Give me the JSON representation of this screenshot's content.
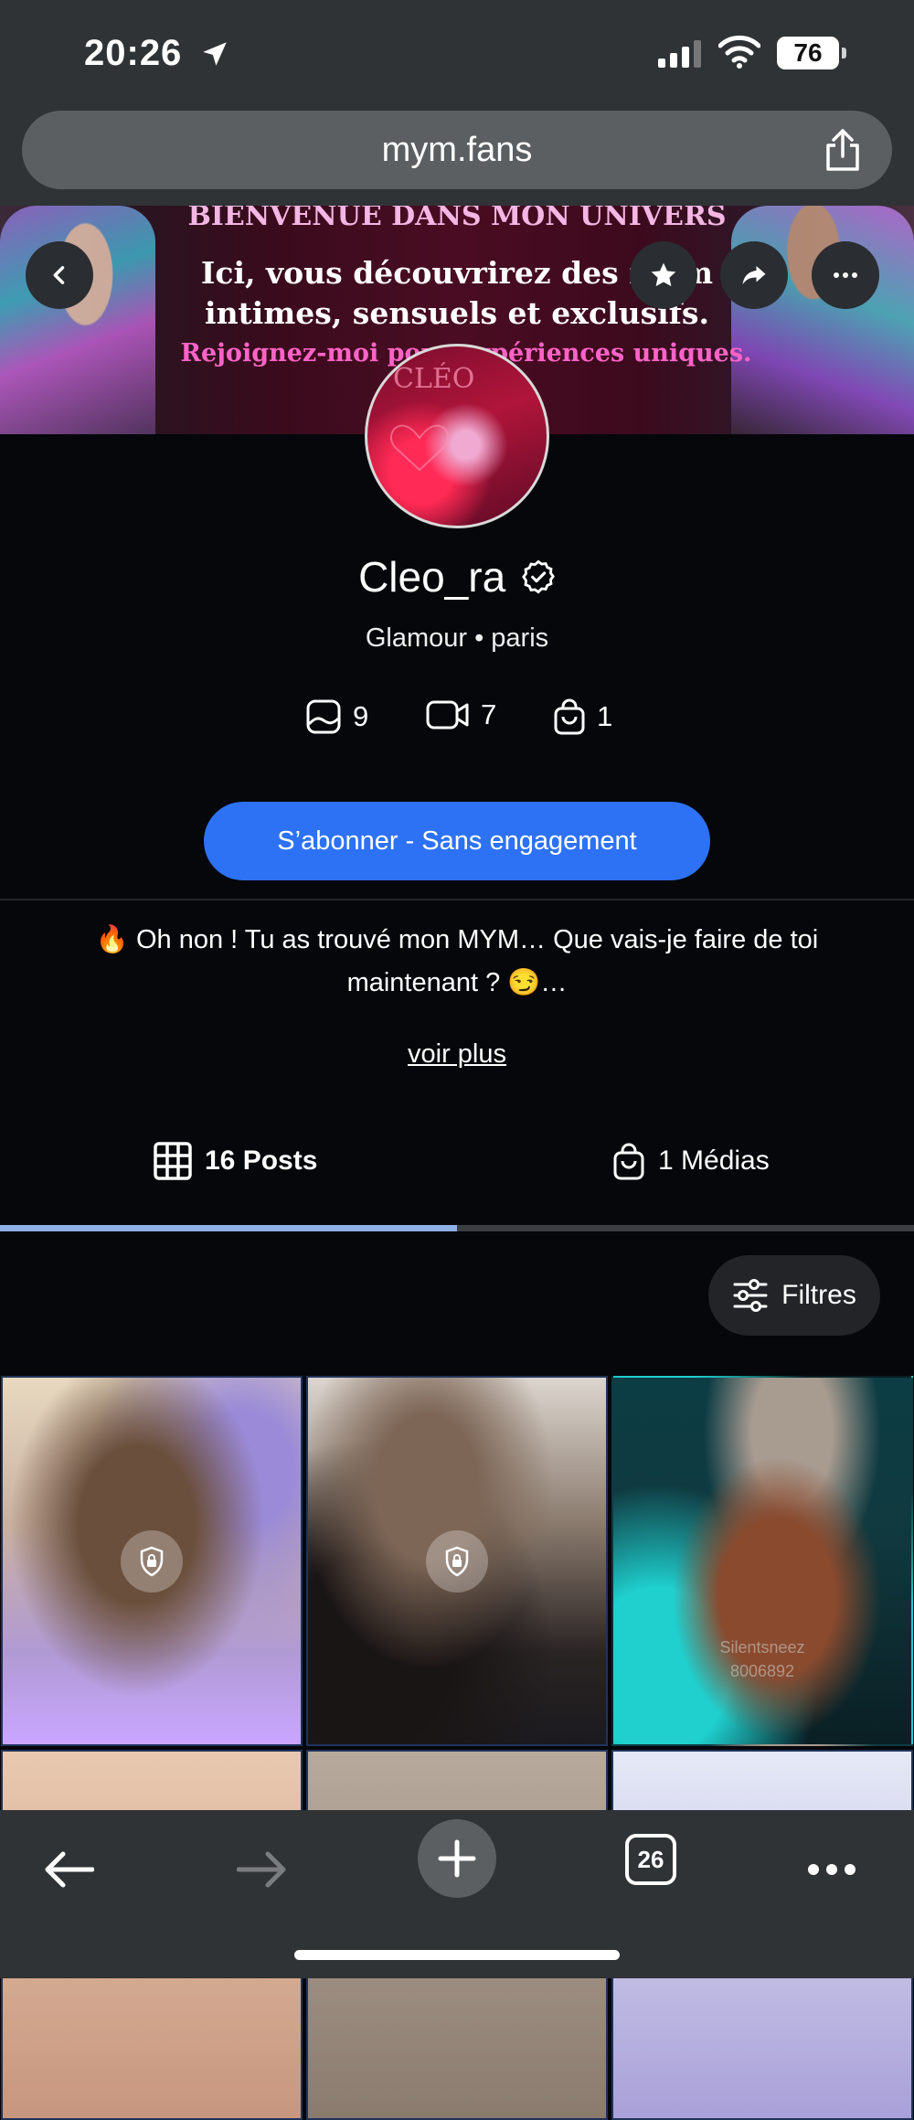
{
  "status_bar": {
    "time": "20:26",
    "battery": "76"
  },
  "browser": {
    "url": "mym.fans",
    "tabs_count": "26"
  },
  "banner": {
    "line1": "BIENVENUE DANS MON UNIVERS",
    "line2a": "Ici, vous découvrirez des mom",
    "line2b": "intimes, sensuels et exclusifs.",
    "line3": "Rejoignez-moi pour   expériences uniques."
  },
  "profile": {
    "avatar_text": "CLÉO",
    "username": "Cleo_ra",
    "subtitle": "Glamour • paris",
    "stats": {
      "photos": "9",
      "videos": "7",
      "purchases": "1"
    },
    "subscribe_label": "S’abonner - Sans engagement",
    "bio_line1": "🔥 Oh non ! Tu as trouvé mon MYM… Que vais-je faire de toi",
    "bio_line2": "maintenant ? 😏…",
    "see_more": "voir plus"
  },
  "tabs": [
    {
      "label": "16 Posts",
      "active": true
    },
    {
      "label": "1 Médias",
      "active": false
    }
  ],
  "filters_label": "Filtres",
  "grid": {
    "watermark_line1": "Silentsneez",
    "watermark_line2": "8006892"
  },
  "colors": {
    "accent": "#2d72f5",
    "tab_indicator": "#8fb0e6",
    "background": "#05070b",
    "chrome": "#2f3336"
  }
}
